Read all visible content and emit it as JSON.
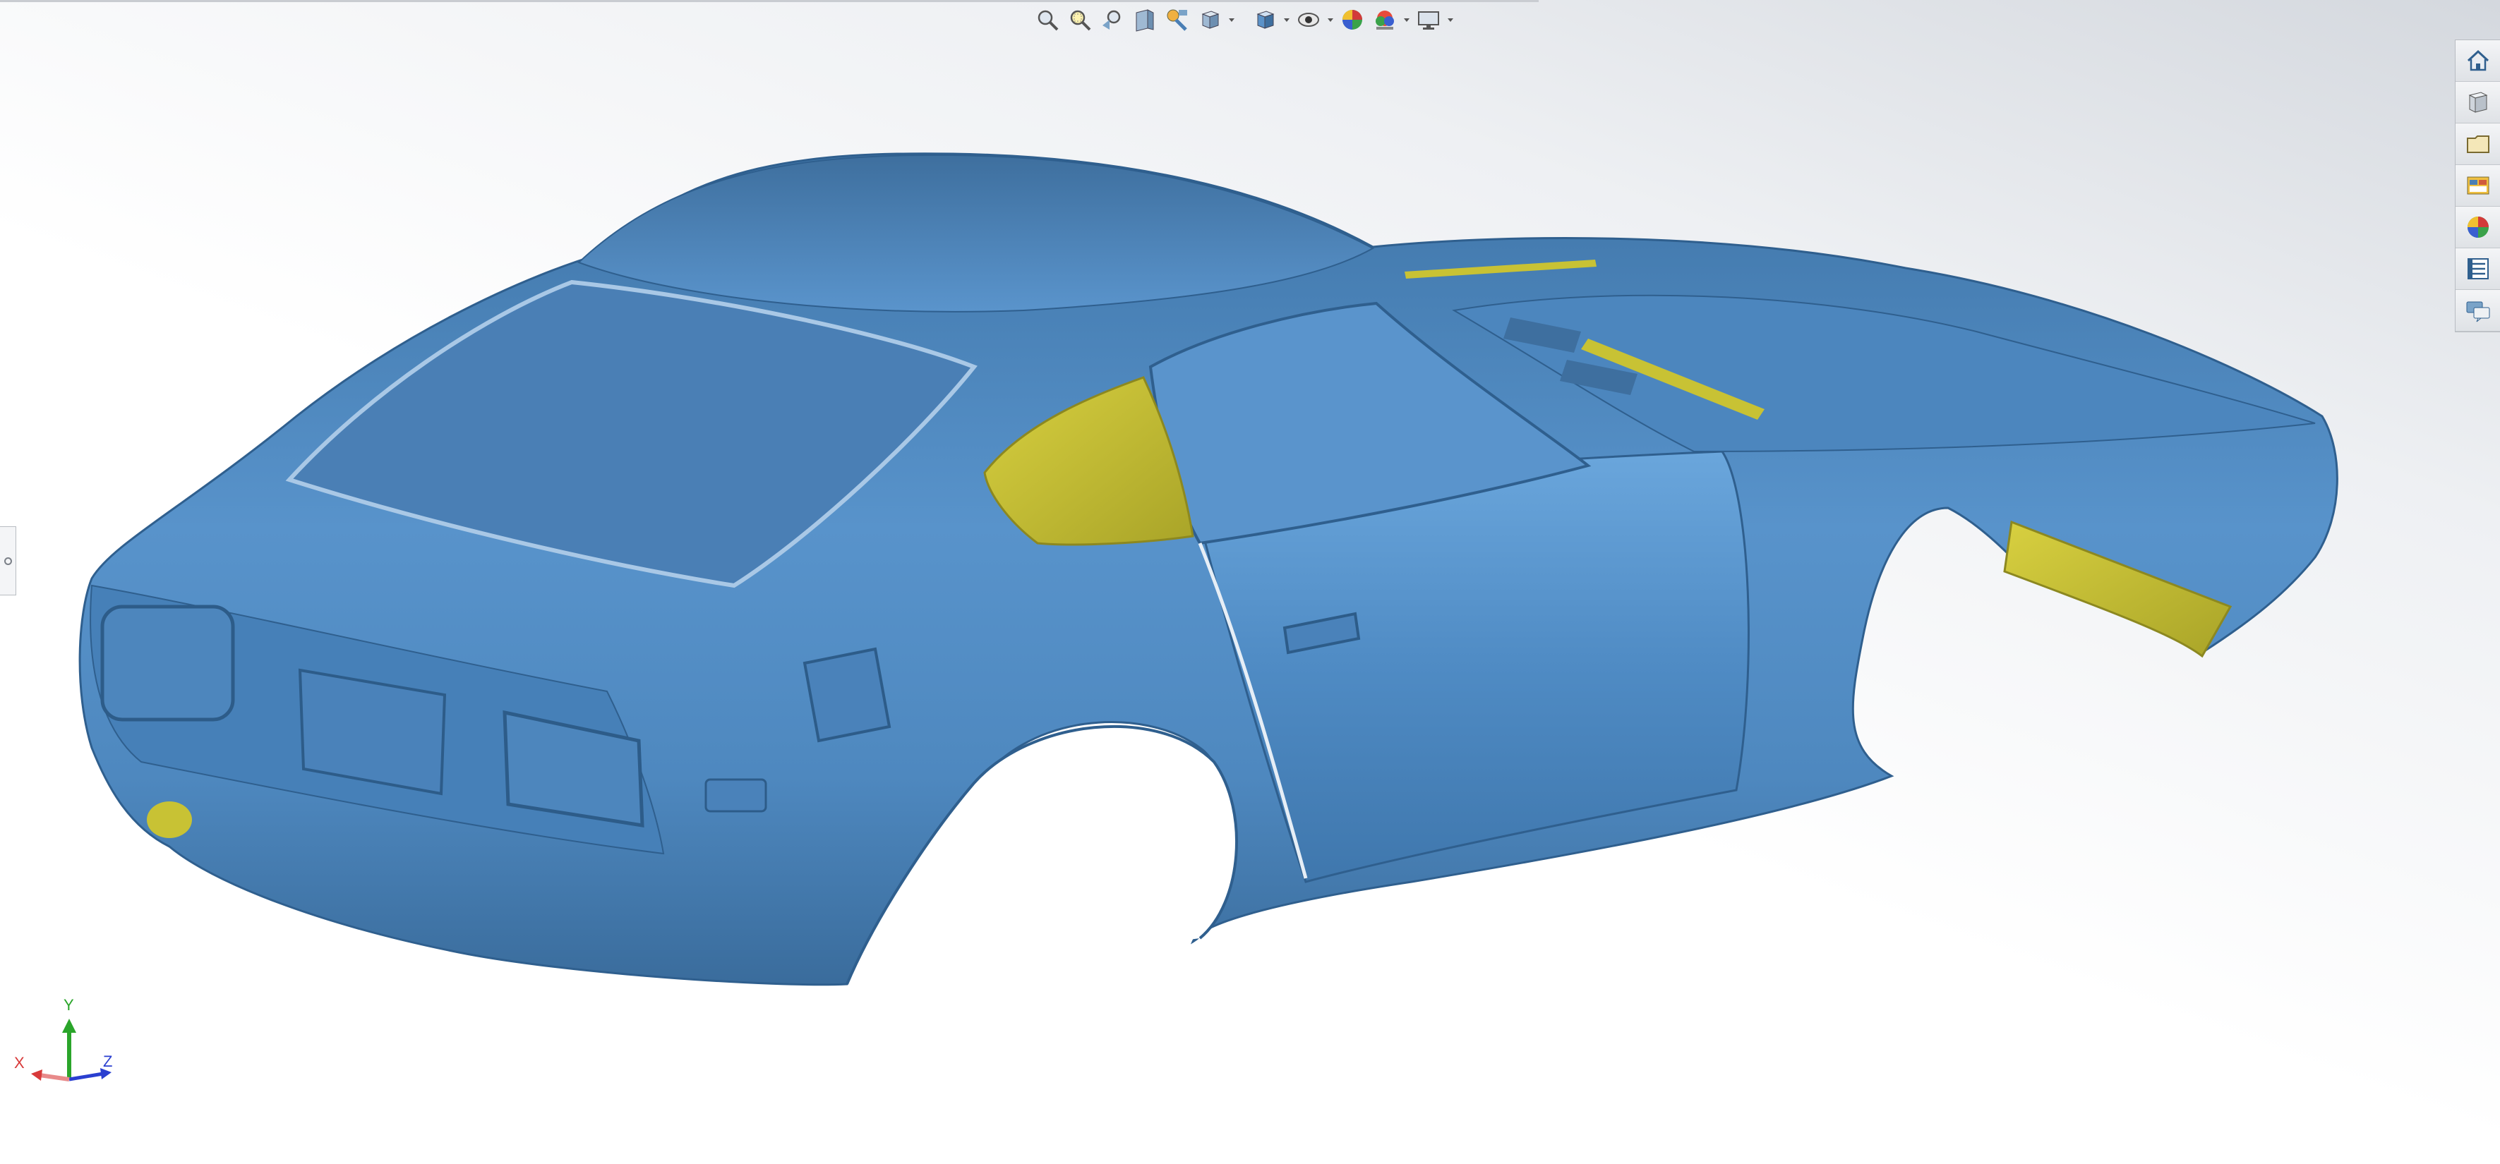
{
  "toolbar": {
    "icons": [
      "zoom-to-fit-icon",
      "zoom-to-area-icon",
      "previous-view-icon",
      "section-view-icon",
      "dynamic-annotation-icon",
      "view-orientation-icon",
      "display-style-icon",
      "hide-show-items-icon",
      "edit-appearance-icon",
      "apply-scene-icon",
      "view-settings-icon"
    ]
  },
  "task_pane": {
    "tabs": [
      "home-icon",
      "resources-icon",
      "design-library-icon",
      "file-explorer-icon",
      "appearances-scenes-icon",
      "custom-properties-icon",
      "forum-icon"
    ]
  },
  "model": {
    "surface_color": "#4f8bc4",
    "highlight_color": "#c8c234"
  },
  "triad": {
    "x_label": "X",
    "y_label": "Y",
    "z_label": "Z",
    "x_color": "#d83a3a",
    "y_color": "#2aa52a",
    "z_color": "#2a3fd0"
  }
}
